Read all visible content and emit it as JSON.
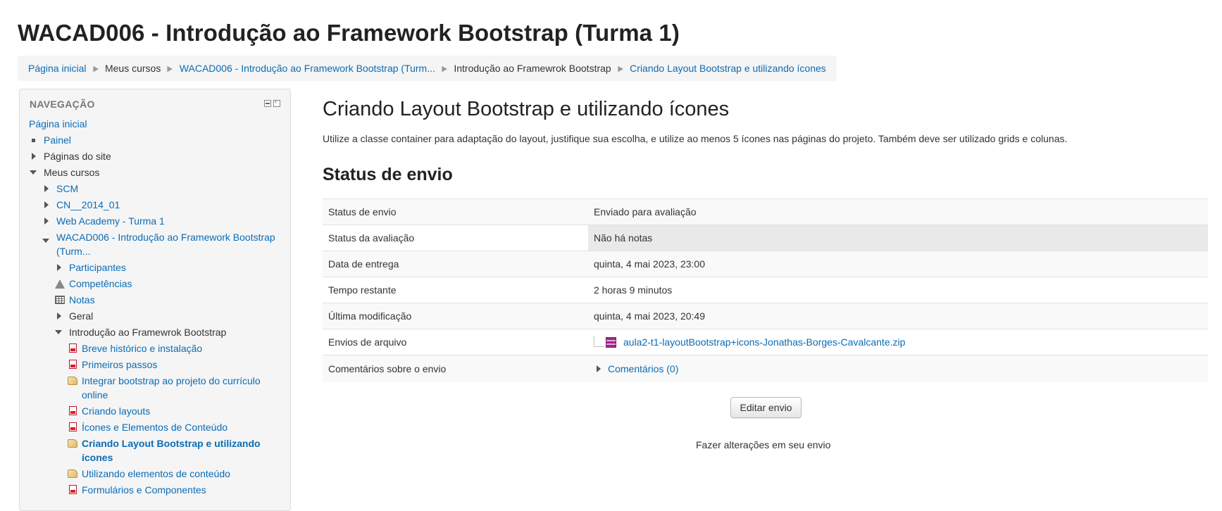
{
  "page": {
    "title": "WACAD006 - Introdução ao Framework Bootstrap (Turma 1)"
  },
  "breadcrumb": [
    {
      "label": "Página inicial"
    },
    {
      "label": "Meus cursos"
    },
    {
      "label": "WACAD006 - Introdução ao Framework Bootstrap (Turm..."
    },
    {
      "label": "Introdução ao Framewrok Bootstrap"
    },
    {
      "label": "Criando Layout Bootstrap e utilizando ícones"
    }
  ],
  "navigation": {
    "header": "NAVEGAÇÃO",
    "items": [
      {
        "label": "Página inicial"
      },
      {
        "label": "Painel"
      },
      {
        "label": "Páginas do site"
      },
      {
        "label": "Meus cursos"
      },
      {
        "label": "SCM"
      },
      {
        "label": "CN__2014_01"
      },
      {
        "label": "Web Academy - Turma 1"
      },
      {
        "label": "WACAD006 - Introdução ao Framework Bootstrap",
        "label2": "(Turm..."
      },
      {
        "label": "Participantes"
      },
      {
        "label": "Competências"
      },
      {
        "label": "Notas"
      },
      {
        "label": "Geral"
      },
      {
        "label": "Introdução ao Framewrok Bootstrap"
      },
      {
        "label": "Breve histórico e instalação"
      },
      {
        "label": "Primeiros passos"
      },
      {
        "label": "Integrar bootstrap ao projeto do currículo",
        "label2": "online"
      },
      {
        "label": "Criando layouts"
      },
      {
        "label": "Ícones e Elementos de Conteúdo"
      },
      {
        "label": "Criando Layout Bootstrap e utilizando",
        "label2": "ícones"
      },
      {
        "label": "Utilizando elementos de conteúdo"
      },
      {
        "label": "Formulários e Componentes"
      }
    ]
  },
  "activity": {
    "title": "Criando Layout Bootstrap e utilizando ícones",
    "description": "Utilize a classe container para adaptação do layout, justifique sua escolha, e utilize ao menos 5 ícones nas páginas do projeto. Também deve ser utilizado grids e colunas."
  },
  "submission_status": {
    "heading": "Status de envio",
    "rows": [
      {
        "label": "Status de envio",
        "value": "Enviado para avaliação"
      },
      {
        "label": "Status da avaliação",
        "value": "Não há notas"
      },
      {
        "label": "Data de entrega",
        "value": "quinta, 4 mai 2023, 23:00"
      },
      {
        "label": "Tempo restante",
        "value": "2 horas 9 minutos"
      },
      {
        "label": "Última modificação",
        "value": "quinta, 4 mai 2023, 20:49"
      },
      {
        "label": "Envios de arquivo",
        "value": "aula2-t1-layoutBootstrap+icons-Jonathas-Borges-Cavalcante.zip"
      },
      {
        "label": "Comentários sobre o envio",
        "value": "Comentários (0)"
      }
    ]
  },
  "actions": {
    "edit_button": "Editar envio",
    "edit_hint": "Fazer alterações em seu envio"
  },
  "colors": {
    "link": "#0a6cb6",
    "pdf_icon": "#d7201f",
    "zip_icon": "#9b2a8a"
  }
}
